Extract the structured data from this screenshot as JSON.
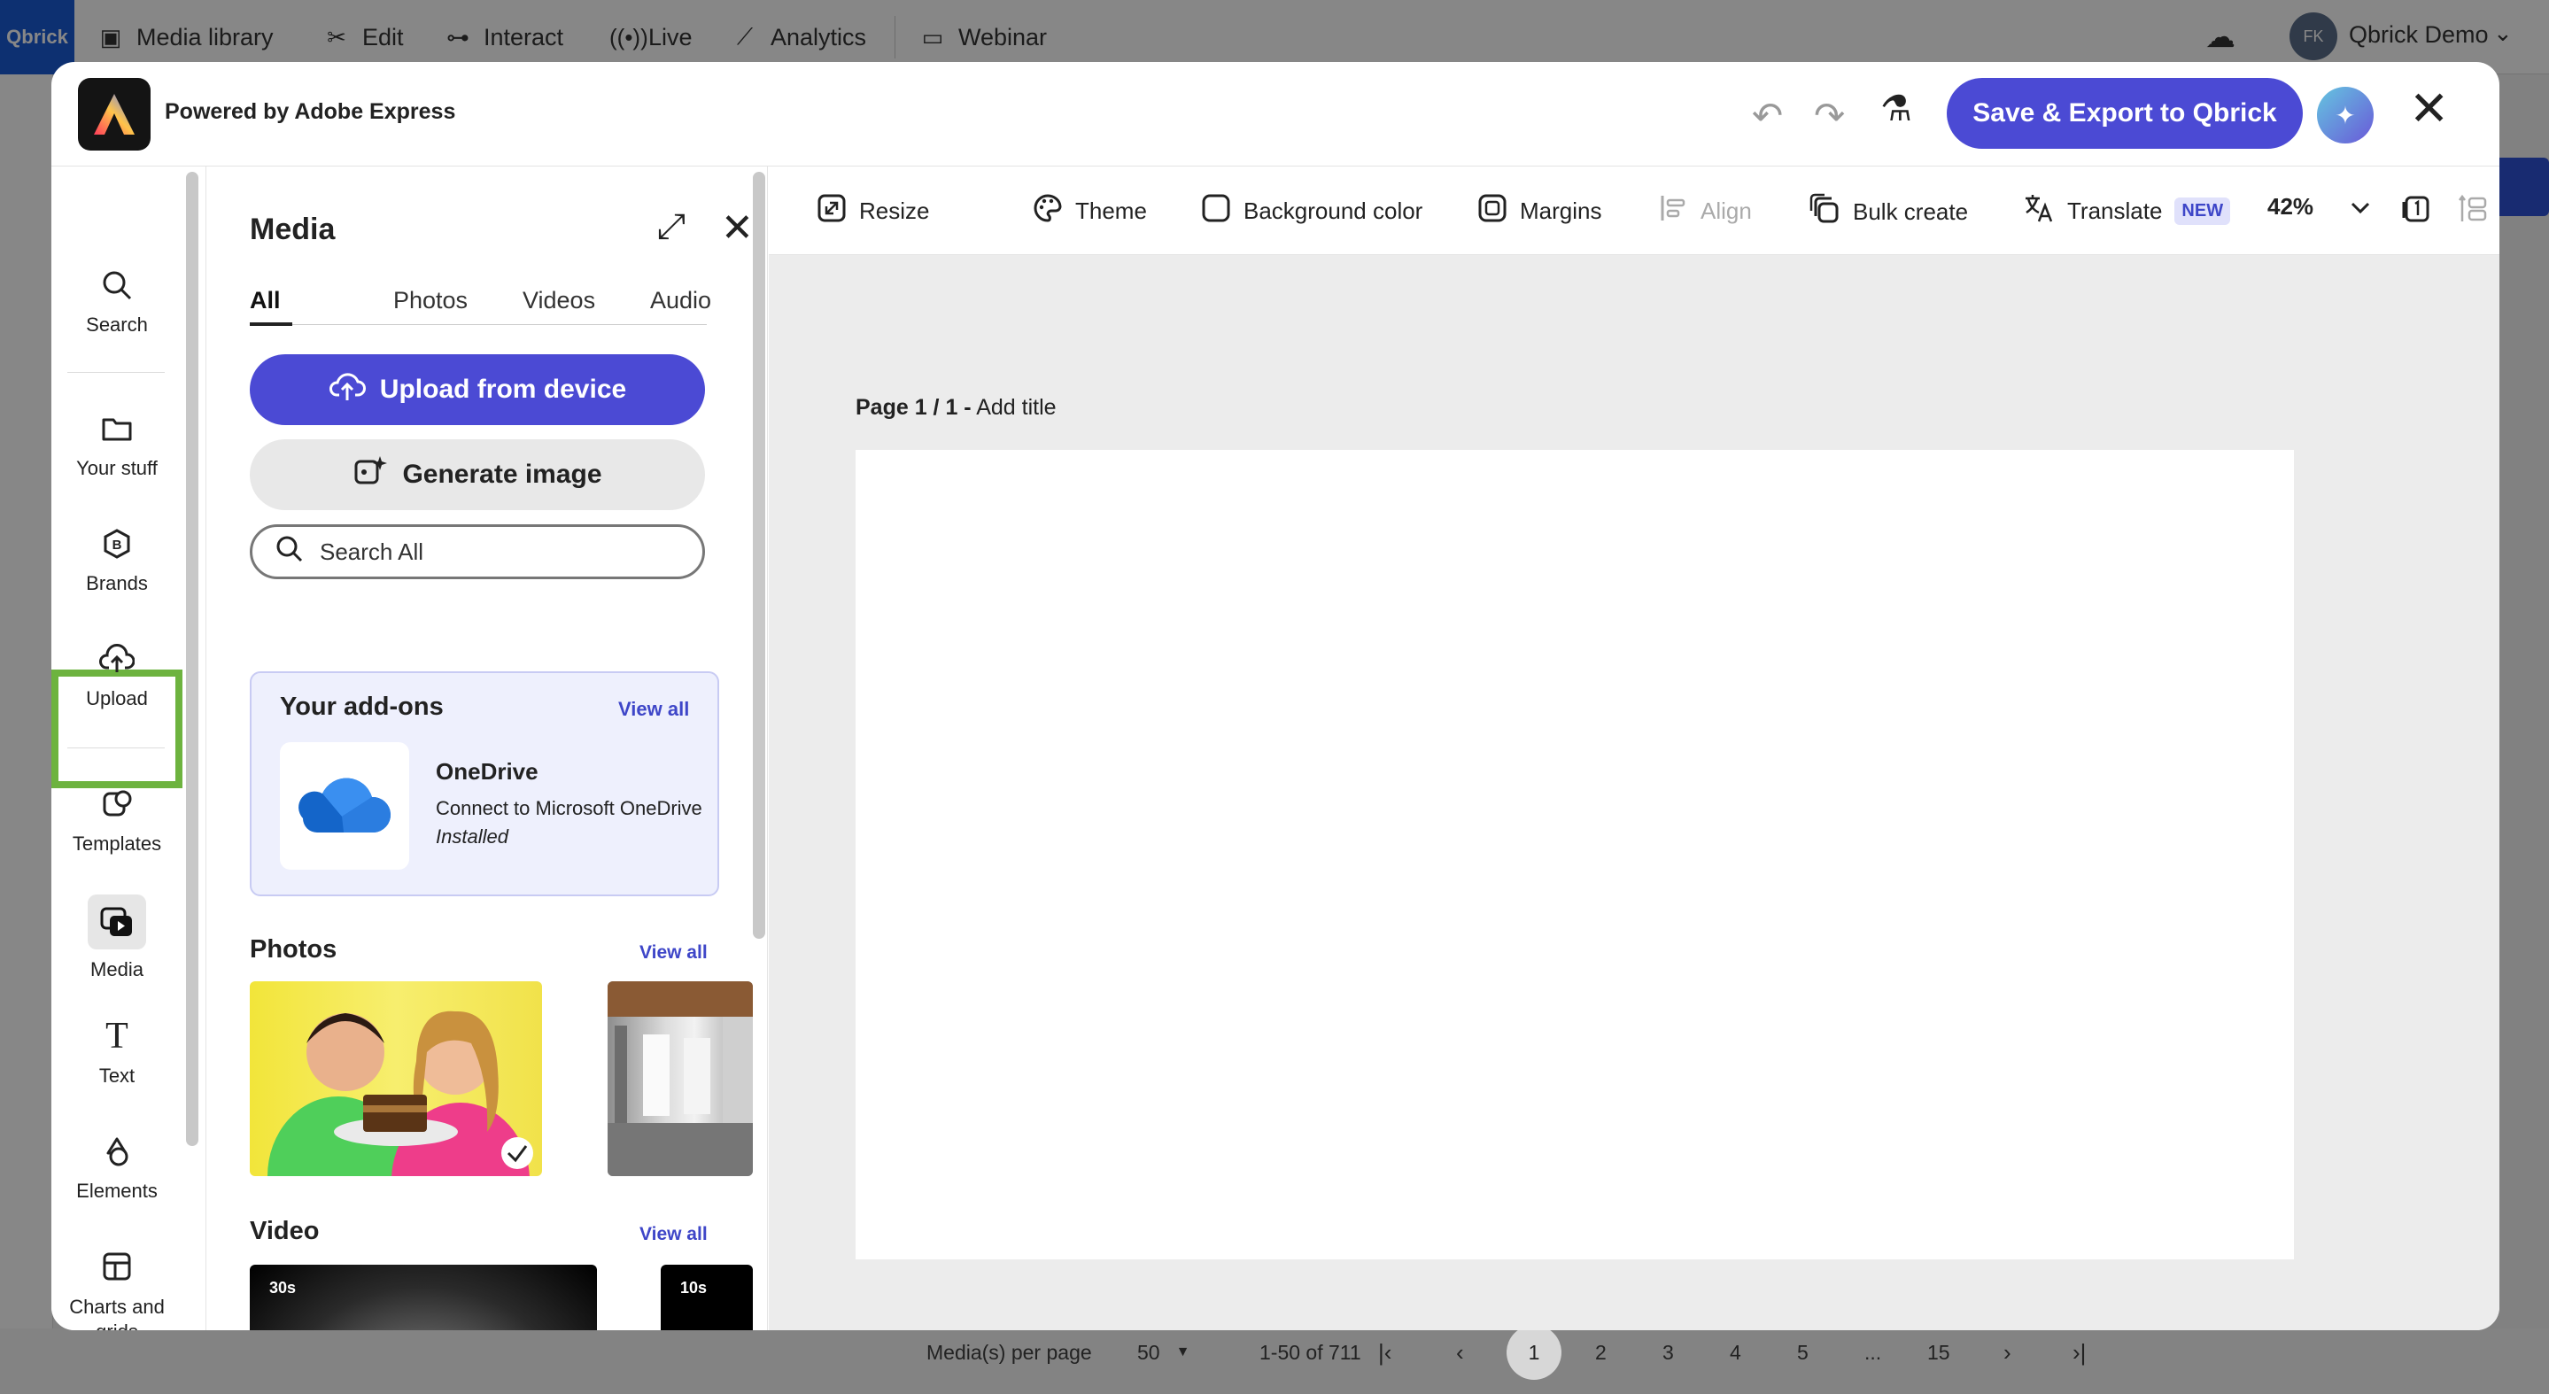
{
  "bg": {
    "logo": "Qbrick",
    "nav": [
      "Media library",
      "Edit",
      "Interact",
      "Live",
      "Analytics",
      "Webinar"
    ],
    "user_initials": "FK",
    "user_name": "Qbrick Demo",
    "pagination": {
      "per_page_label": "Media(s) per page",
      "per_page_value": "50",
      "range": "1-50 of 711",
      "pages": [
        "1",
        "2",
        "3",
        "4",
        "5",
        "...",
        "15"
      ],
      "current_page": "1"
    }
  },
  "modal": {
    "powered_by": "Powered by Adobe Express",
    "save_button": "Save & Export to Qbrick"
  },
  "rail": {
    "items": [
      {
        "label": "Search",
        "icon": "search-icon"
      },
      {
        "label": "Your stuff",
        "icon": "folder-icon"
      },
      {
        "label": "Brands",
        "icon": "brand-icon"
      },
      {
        "label": "Upload",
        "icon": "upload-icon"
      },
      {
        "label": "Templates",
        "icon": "templates-icon"
      },
      {
        "label": "Media",
        "icon": "media-icon"
      },
      {
        "label": "Text",
        "icon": "text-icon"
      },
      {
        "label": "Elements",
        "icon": "elements-icon"
      },
      {
        "label": "Charts and grids",
        "icon": "charts-grid-icon"
      }
    ]
  },
  "panel": {
    "title": "Media",
    "tabs": [
      "All",
      "Photos",
      "Videos",
      "Audio"
    ],
    "active_tab": "All",
    "upload_button": "Upload from device",
    "generate_button": "Generate image",
    "search_placeholder": "Search All",
    "addons": {
      "title": "Your add-ons",
      "view_all": "View all",
      "item_name": "OneDrive",
      "item_desc": "Connect to Microsoft OneDrive",
      "item_status": "Installed"
    },
    "photos": {
      "title": "Photos",
      "view_all": "View all"
    },
    "video": {
      "title": "Video",
      "view_all": "View all",
      "durations": [
        "30s",
        "10s"
      ]
    }
  },
  "toolbar": {
    "resize": "Resize",
    "theme": "Theme",
    "background_color": "Background color",
    "margins": "Margins",
    "align": "Align",
    "bulk_create": "Bulk create",
    "translate": "Translate",
    "new_badge": "NEW",
    "zoom": "42%"
  },
  "canvas": {
    "page_number": "Page 1 / 1 -",
    "add_title": "Add title"
  },
  "colors": {
    "accent": "#4b4ad4",
    "upload_highlight": "#6db33f",
    "link": "#3e46c8"
  }
}
